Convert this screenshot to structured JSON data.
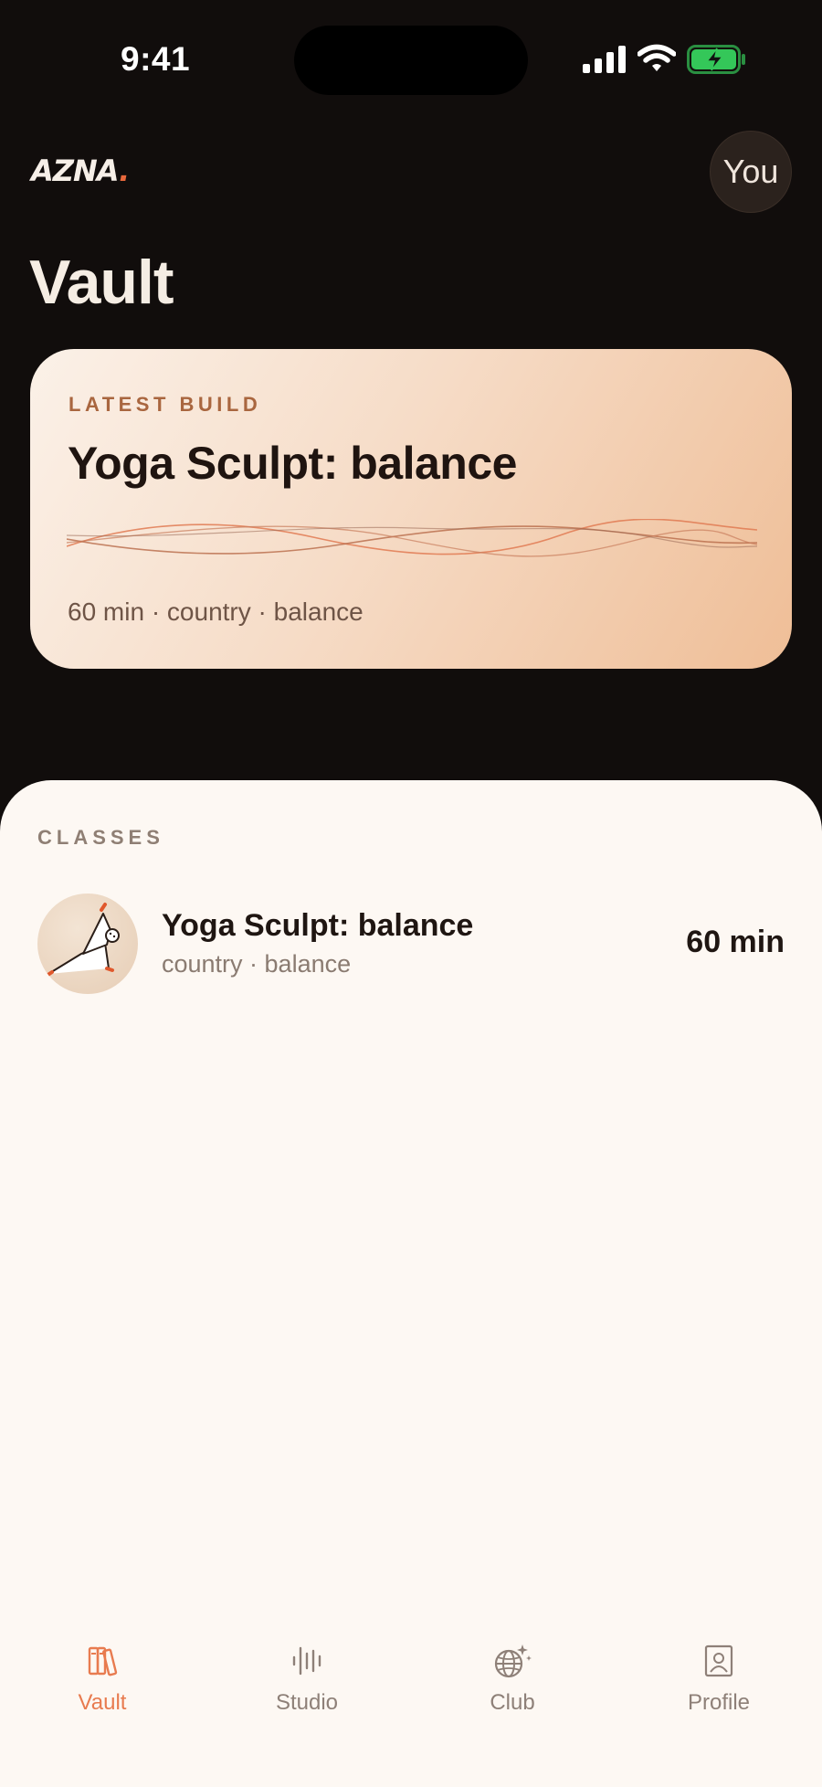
{
  "status_bar": {
    "time": "9:41"
  },
  "header": {
    "logo": "AZNA",
    "logo_dot": ".",
    "avatar_label": "You"
  },
  "page": {
    "title": "Vault"
  },
  "hero": {
    "eyebrow": "LATEST BUILD",
    "title": "Yoga Sculpt: balance",
    "meta": "60 min · country · balance"
  },
  "classes": {
    "section_label": "CLASSES",
    "items": [
      {
        "title": "Yoga Sculpt: balance",
        "meta": "country · balance",
        "duration": "60 min"
      }
    ]
  },
  "tab_bar": {
    "active": "Vault",
    "tabs": [
      {
        "label": "Vault",
        "icon": "books-icon"
      },
      {
        "label": "Studio",
        "icon": "waveform-icon"
      },
      {
        "label": "Club",
        "icon": "disco-ball-icon"
      },
      {
        "label": "Profile",
        "icon": "profile-card-icon"
      }
    ]
  },
  "colors": {
    "background": "#110d0c",
    "sheet": "#fdf8f3",
    "accent": "#e87b4f",
    "hero_gradient_start": "#fbf1e8",
    "hero_gradient_end": "#efbe97",
    "battery": "#34c759"
  }
}
